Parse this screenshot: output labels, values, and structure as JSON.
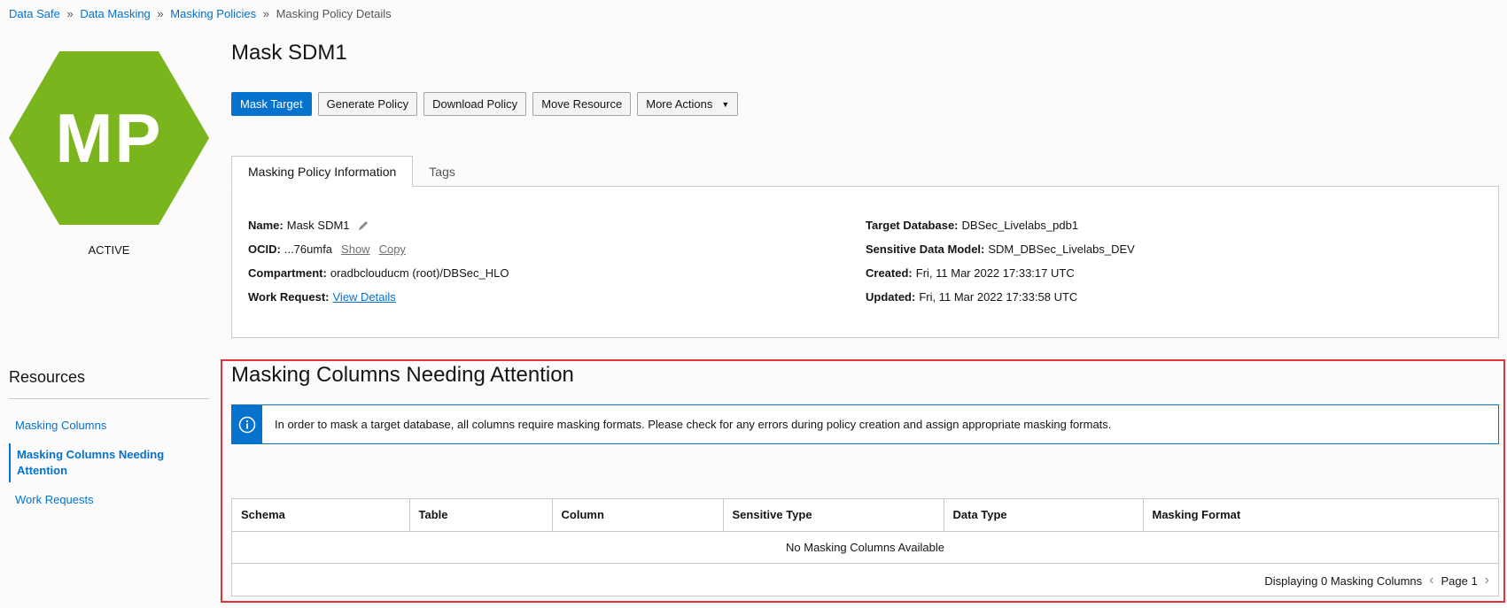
{
  "breadcrumb": {
    "items": [
      "Data Safe",
      "Data Masking",
      "Masking Policies"
    ],
    "current": "Masking Policy Details",
    "separator": "»"
  },
  "badge": {
    "initials": "MP",
    "color": "#7ab51d",
    "status": "ACTIVE"
  },
  "page": {
    "title": "Mask SDM1"
  },
  "actions": {
    "mask_target": "Mask Target",
    "generate_policy": "Generate Policy",
    "download_policy": "Download Policy",
    "move_resource": "Move Resource",
    "more_actions": "More Actions"
  },
  "tabs": {
    "info": "Masking Policy Information",
    "tags": "Tags"
  },
  "info": {
    "name_label": "Name:",
    "name_value": "Mask SDM1",
    "ocid_label": "OCID:",
    "ocid_value": "...76umfa",
    "show": "Show",
    "copy": "Copy",
    "compartment_label": "Compartment:",
    "compartment_value": "oradbclouducm (root)/DBSec_HLO",
    "work_request_label": "Work Request:",
    "work_request_link": "View Details",
    "target_db_label": "Target Database:",
    "target_db_value": "DBSec_Livelabs_pdb1",
    "sdm_label": "Sensitive Data Model:",
    "sdm_value": "SDM_DBSec_Livelabs_DEV",
    "created_label": "Created:",
    "created_value": "Fri, 11 Mar 2022 17:33:17 UTC",
    "updated_label": "Updated:",
    "updated_value": "Fri, 11 Mar 2022 17:33:58 UTC"
  },
  "resources": {
    "title": "Resources",
    "items": [
      "Masking Columns",
      "Masking Columns Needing Attention",
      "Work Requests"
    ],
    "active_index": 1
  },
  "section": {
    "title": "Masking Columns Needing Attention",
    "banner": "In order to mask a target database, all columns require masking formats. Please check for any errors during policy creation and assign appropriate masking formats."
  },
  "table": {
    "columns": [
      "Schema",
      "Table",
      "Column",
      "Sensitive Type",
      "Data Type",
      "Masking Format"
    ],
    "empty_text": "No Masking Columns Available",
    "footer": "Displaying 0 Masking Columns",
    "page": "Page 1"
  },
  "colors": {
    "accent": "#0572ce",
    "highlight": "#e5333b"
  }
}
